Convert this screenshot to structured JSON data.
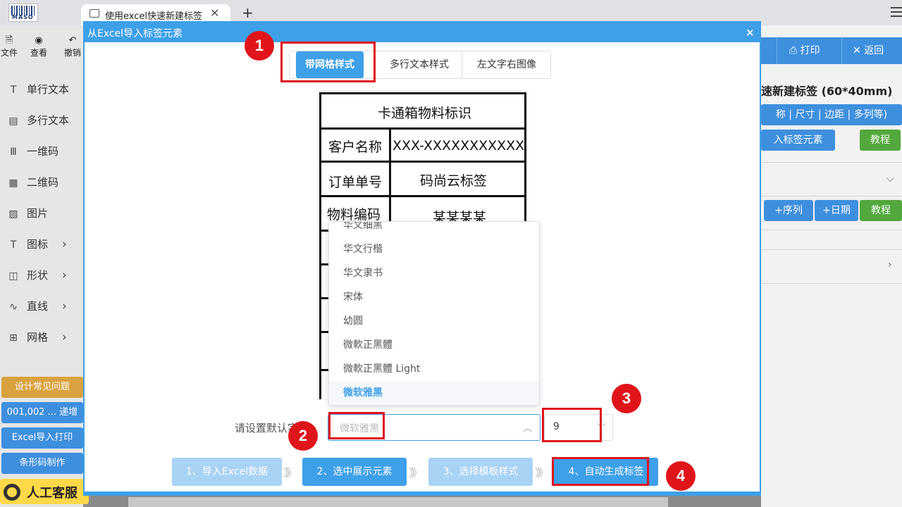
{
  "browser": {
    "logo_text": "MASO",
    "tab_title": "使用excel快速新建标签",
    "tab_close": "✕",
    "new_tab": "+"
  },
  "sidebar": {
    "tools": [
      {
        "icon": "file-icon",
        "glyph": "🗎",
        "label": "文件"
      },
      {
        "icon": "eye-icon",
        "glyph": "◉",
        "label": "查看"
      },
      {
        "icon": "undo-icon",
        "glyph": "↶",
        "label": "撤销"
      }
    ],
    "menu": [
      {
        "glyph": "T",
        "label": "单行文本"
      },
      {
        "glyph": "▤",
        "label": "多行文本"
      },
      {
        "glyph": "Ⅲ",
        "label": "一维码"
      },
      {
        "glyph": "▦",
        "label": "二维码"
      },
      {
        "glyph": "▨",
        "label": "图片"
      },
      {
        "glyph": "T",
        "label": "图标",
        "chevron": "›"
      },
      {
        "glyph": "◫",
        "label": "形状",
        "chevron": "›"
      },
      {
        "glyph": "∿",
        "label": "直线",
        "chevron": "›"
      },
      {
        "glyph": "⊞",
        "label": "网格",
        "chevron": "›"
      }
    ],
    "buttons": [
      {
        "label": "设计常见问题",
        "color": "#d9a23f"
      },
      {
        "label": "001,002 ... 递增",
        "color": "#3e8fde"
      },
      {
        "label": "Excel导入打印",
        "color": "#3e8fde"
      },
      {
        "label": "条形码制作",
        "color": "#3e8fde"
      }
    ],
    "service_label": "人工客服"
  },
  "right_panel": {
    "print_label": "打印",
    "back_label": "返回",
    "title": "速新建标签 (60*40mm)",
    "props_label": "称 | 尺寸 | 边距 | 多列等)",
    "import_label": "入标签元素",
    "tutorial_label": "教程",
    "seq_label": "+序列",
    "date_label": "+日期",
    "tutorial2_label": "教程",
    "colors": {
      "blue": "#3e8fde",
      "green": "#52a83c"
    }
  },
  "modal": {
    "title": "从Excel导入标签元素",
    "close": "×",
    "style_tabs": [
      "带网格样式",
      "多行文本样式",
      "左文字右图像"
    ],
    "active_tab": 0,
    "label_preview": {
      "title": "卡通箱物料标识",
      "rows": [
        {
          "key": "客户名称",
          "value": "XXX-XXXXXXXXXXXX"
        },
        {
          "key": "订单单号",
          "value": "码尚云标签"
        },
        {
          "key": "物料编码",
          "value": "某某某某"
        }
      ]
    },
    "font_options": [
      "华文细黑",
      "华文行楷",
      "华文隶书",
      "宋体",
      "幼圆",
      "微軟正黑體",
      "微軟正黑體 Light",
      "微软雅黑"
    ],
    "selected_font_index": 7,
    "font_label": "请设置默认字",
    "font_value": "微软雅黑",
    "size_value": "9",
    "steps": [
      {
        "label": "1、导入Excel数据",
        "state": "faded"
      },
      {
        "label": "2、选中展示元素",
        "state": "active"
      },
      {
        "label": "3、选择模板样式",
        "state": "faded"
      },
      {
        "label": "4、自动生成标签",
        "state": "active"
      }
    ],
    "step_arrow": "》》"
  },
  "annotations": [
    "1",
    "2",
    "3",
    "4"
  ],
  "colors": {
    "accent": "#3ea0e8",
    "annotation_red": "#e0141b"
  }
}
